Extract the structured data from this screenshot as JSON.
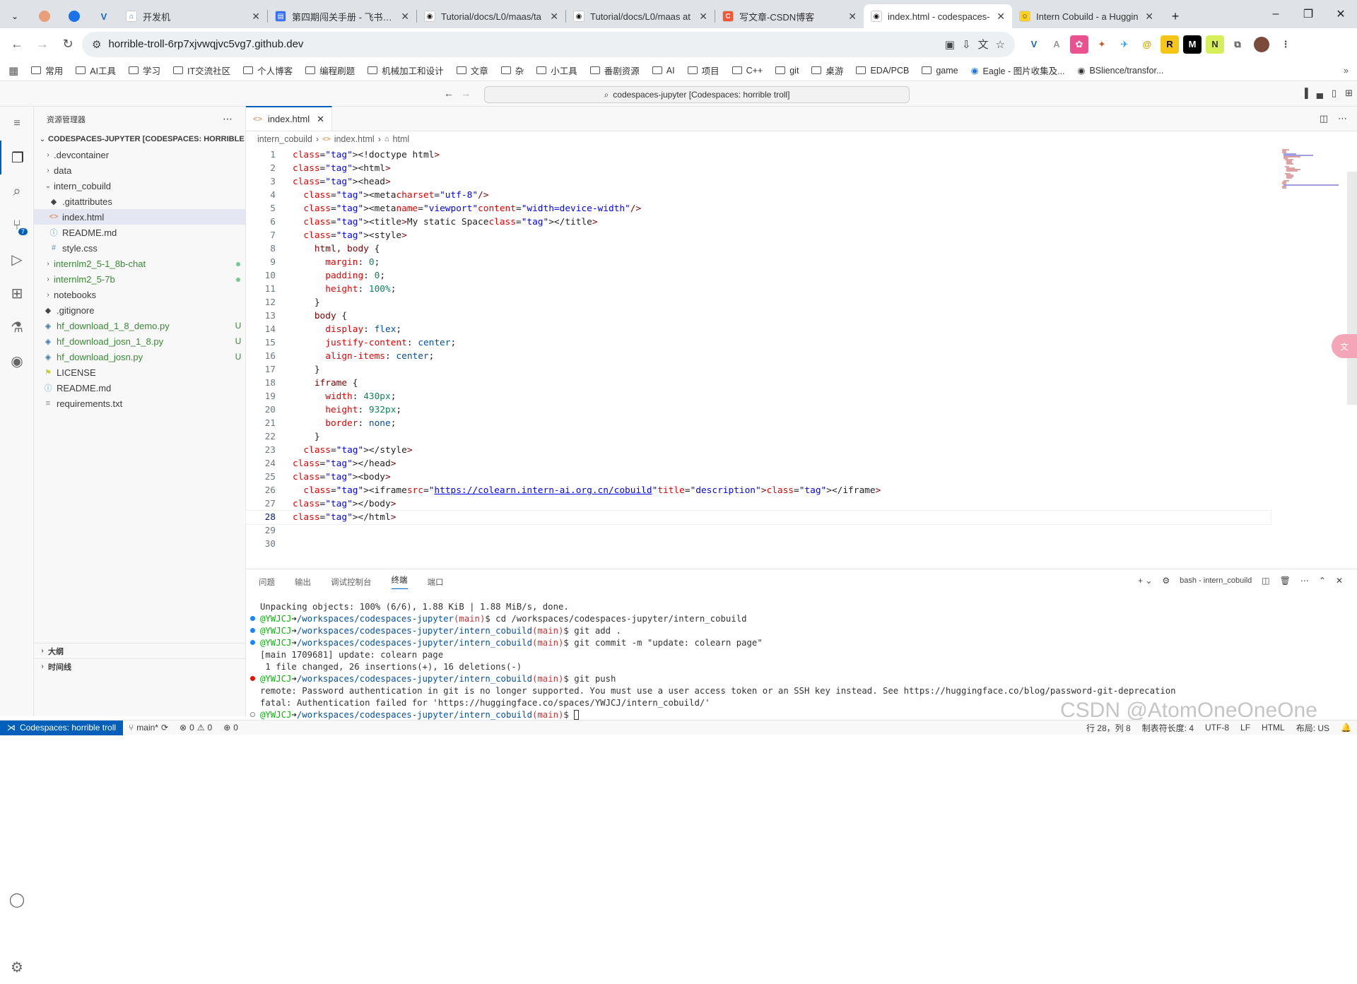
{
  "browser": {
    "tabs": [
      {
        "title": "开发机",
        "active": false
      },
      {
        "title": "第四期闯关手册 - 飞书云文",
        "active": false
      },
      {
        "title": "Tutorial/docs/L0/maas/ta",
        "active": false
      },
      {
        "title": "Tutorial/docs/L0/maas at",
        "active": false
      },
      {
        "title": "写文章-CSDN博客",
        "active": false
      },
      {
        "title": "index.html - codespaces-",
        "active": true
      },
      {
        "title": "Intern Cobuild - a Huggin",
        "active": false
      }
    ],
    "url": "horrible-troll-6rp7xjvwqjvc5vg7.github.dev",
    "bookmarks": [
      "常用",
      "AI工具",
      "学习",
      "IT交流社区",
      "个人博客",
      "编程刷题",
      "机械加工和设计",
      "文章",
      "杂",
      "小工具",
      "番剧资源",
      "AI",
      "项目",
      "C++",
      "git",
      "桌游",
      "EDA/PCB",
      "game",
      "Eagle - 图片收集及...",
      "BSlience/transfor..."
    ]
  },
  "vscode": {
    "command_center": "codespaces-jupyter [Codespaces: horrible troll]",
    "explorer_title": "资源管理器",
    "workspace_title": "CODESPACES-JUPYTER [CODESPACES: HORRIBLE TR...",
    "tree": [
      {
        "label": ".devcontainer",
        "type": "folder",
        "depth": 0,
        "expanded": false,
        "status": ""
      },
      {
        "label": "data",
        "type": "folder",
        "depth": 0,
        "expanded": false,
        "status": ""
      },
      {
        "label": "intern_cobuild",
        "type": "folder",
        "depth": 0,
        "expanded": true,
        "status": ""
      },
      {
        "label": ".gitattributes",
        "type": "git",
        "depth": 1,
        "expanded": false,
        "status": ""
      },
      {
        "label": "index.html",
        "type": "html",
        "depth": 1,
        "expanded": false,
        "status": "",
        "selected": true
      },
      {
        "label": "README.md",
        "type": "info",
        "depth": 1,
        "expanded": false,
        "status": ""
      },
      {
        "label": "style.css",
        "type": "css",
        "depth": 1,
        "expanded": false,
        "status": ""
      },
      {
        "label": "internlm2_5-1_8b-chat",
        "type": "folder",
        "depth": 0,
        "expanded": false,
        "status": "dot"
      },
      {
        "label": "internlm2_5-7b",
        "type": "folder",
        "depth": 0,
        "expanded": false,
        "status": "dot"
      },
      {
        "label": "notebooks",
        "type": "folder",
        "depth": 0,
        "expanded": false,
        "status": ""
      },
      {
        "label": ".gitignore",
        "type": "git",
        "depth": 0,
        "expanded": false,
        "status": ""
      },
      {
        "label": "hf_download_1_8_demo.py",
        "type": "py",
        "depth": 0,
        "expanded": false,
        "status": "U"
      },
      {
        "label": "hf_download_josn_1_8.py",
        "type": "py",
        "depth": 0,
        "expanded": false,
        "status": "U"
      },
      {
        "label": "hf_download_josn.py",
        "type": "py",
        "depth": 0,
        "expanded": false,
        "status": "U"
      },
      {
        "label": "LICENSE",
        "type": "license",
        "depth": 0,
        "expanded": false,
        "status": ""
      },
      {
        "label": "README.md",
        "type": "info",
        "depth": 0,
        "expanded": false,
        "status": ""
      },
      {
        "label": "requirements.txt",
        "type": "txt",
        "depth": 0,
        "expanded": false,
        "status": ""
      }
    ],
    "outline_label": "大纲",
    "timeline_label": "时间线",
    "editor_tab": "index.html",
    "breadcrumbs": [
      "intern_cobuild",
      "index.html",
      "html"
    ],
    "code_lines": [
      "<!doctype html>",
      "<html>",
      "<head>",
      "  <meta charset=\"utf-8\" />",
      "  <meta name=\"viewport\" content=\"width=device-width\" />",
      "  <title>My static Space</title>",
      "  <style>",
      "    html, body {",
      "      margin: 0;",
      "      padding: 0;",
      "      height: 100%;",
      "    }",
      "    body {",
      "      display: flex;",
      "      justify-content: center;",
      "      align-items: center;",
      "    }",
      "    iframe {",
      "      width: 430px;",
      "      height: 932px;",
      "      border: none;",
      "    }",
      "  </style>",
      "</head>",
      "<body>",
      "  <iframe src=\"https://colearn.intern-ai.org.cn/cobuild\" title=\"description\"></iframe>",
      "</body>",
      "</html>",
      "",
      ""
    ],
    "current_line": 28,
    "panel_tabs": [
      "问题",
      "输出",
      "调试控制台",
      "终端",
      "端口"
    ],
    "active_panel_tab": "终端",
    "terminal_name": "bash - intern_cobuild",
    "terminal_lines": [
      {
        "dot": "",
        "text": "Unpacking objects: 100% (6/6), 1.88 KiB | 1.88 MiB/s, done."
      },
      {
        "dot": "blue",
        "prompt": true,
        "path": "/workspaces/codespaces-jupyter",
        "branch": "(main)",
        "cmd": "$ cd /workspaces/codespaces-jupyter/intern_cobuild"
      },
      {
        "dot": "blue",
        "prompt": true,
        "path": "/workspaces/codespaces-jupyter/intern_cobuild",
        "branch": "(main)",
        "cmd": "$ git add ."
      },
      {
        "dot": "blue",
        "prompt": true,
        "path": "/workspaces/codespaces-jupyter/intern_cobuild",
        "branch": "(main)",
        "cmd": "$ git commit -m \"update: colearn page\""
      },
      {
        "dot": "",
        "text": "[main 1709681] update: colearn page"
      },
      {
        "dot": "",
        "text": " 1 file changed, 26 insertions(+), 16 deletions(-)"
      },
      {
        "dot": "red",
        "prompt": true,
        "path": "/workspaces/codespaces-jupyter/intern_cobuild",
        "branch": "(main)",
        "cmd": "$ git push"
      },
      {
        "dot": "",
        "text": "remote: Password authentication in git is no longer supported. You must use a user access token or an SSH key instead. See https://huggingface.co/blog/password-git-deprecation"
      },
      {
        "dot": "",
        "text": "fatal: Authentication failed for 'https://huggingface.co/spaces/YWJCJ/intern_cobuild/'"
      },
      {
        "dot": "hollow",
        "prompt": true,
        "path": "/workspaces/codespaces-jupyter/intern_cobuild",
        "branch": "(main)",
        "cmd": "$ "
      }
    ],
    "prompt_user": "@YWJCJ",
    "status": {
      "remote": "Codespaces: horrible troll",
      "branch": "main*",
      "errors": "0",
      "warnings": "0",
      "ports": "0",
      "position": "行 28，列 8",
      "tab_size": "制表符长度: 4",
      "encoding": "UTF-8",
      "eol": "LF",
      "language": "HTML",
      "layout": "布局: US"
    },
    "scm_badge": "7"
  },
  "watermark": "CSDN @AtomOneOneOne",
  "colors": {
    "accent": "#005fb8",
    "tabbar": "#dfe3e8",
    "untracked": "#388a34"
  }
}
